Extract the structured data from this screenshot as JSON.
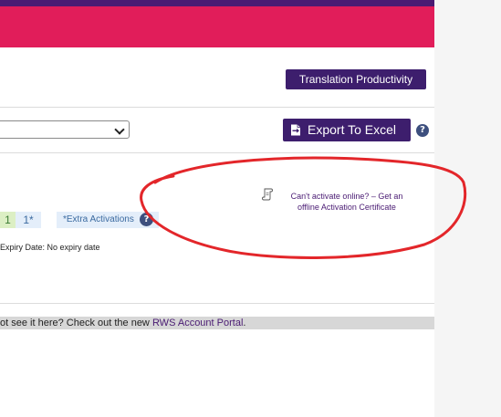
{
  "header": {
    "badge_label": "Translation Productivity"
  },
  "toolbar": {
    "select_value": "",
    "export_label": "Export To Excel",
    "help_glyph": "?"
  },
  "activations": {
    "used": "1",
    "total": "1*",
    "extra_label": "*Extra Activations",
    "help_glyph": "?",
    "expiry_text": "Expiry Date: No expiry date"
  },
  "offline": {
    "line1": "Can't activate online? – Get an",
    "line2": "offline Activation Certificate"
  },
  "notice": {
    "prefix": "ot see it here? Check out the new ",
    "link_text": "RWS Account Portal",
    "suffix": "."
  },
  "icons": {
    "export": "excel-export-icon",
    "certificate": "certificate-scroll-icon",
    "help": "question-circle-icon"
  },
  "colors": {
    "top_bar": "#4a1b73",
    "banner": "#e11d5a",
    "primary_button": "#3d1e6d",
    "annotation_circle": "#e3262a",
    "activation_used": "#dcefc4",
    "activation_total": "#e4eefa"
  }
}
